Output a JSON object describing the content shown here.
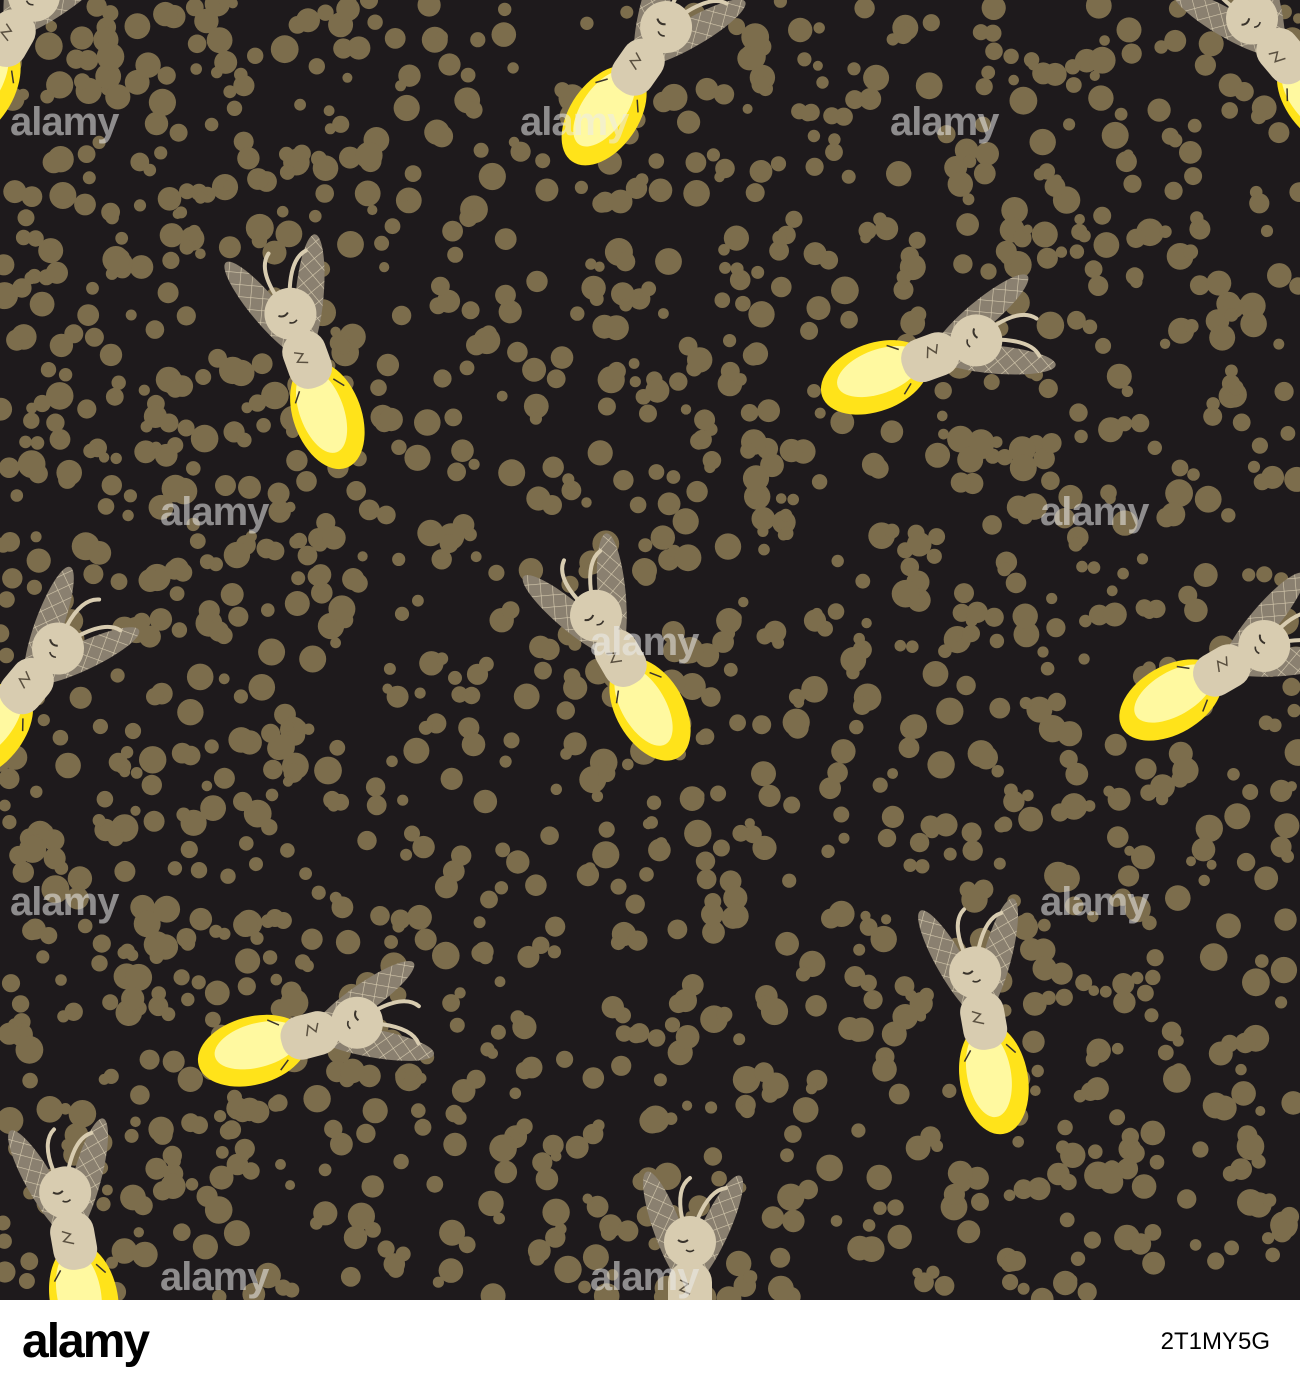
{
  "colors": {
    "background": "#1e1a1c",
    "dots": "#7c6d4c",
    "body": "#d8ccb0",
    "wing": "#8a8070",
    "wing_lines": "#d8ccb0",
    "glow_outer": "#ffe31a",
    "glow_inner": "#fff9a0",
    "footer_bg": "#ffffff"
  },
  "subject": {
    "pattern": "seamless-polka-dot-fireflies",
    "icon": "firefly-icon",
    "firefly_count": 12
  },
  "watermark": {
    "text": "alamy"
  },
  "footer": {
    "logo": "alamy",
    "image_id": "2T1MY5G"
  }
}
